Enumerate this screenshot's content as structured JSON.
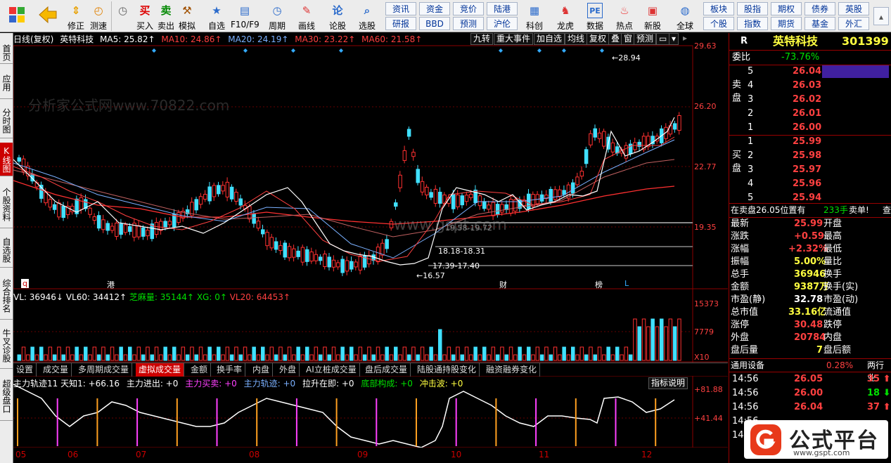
{
  "toolbar": {
    "big_buttons": [
      {
        "label": "",
        "icon": "grid-icon"
      },
      {
        "label": "",
        "icon": "back-arrow-icon"
      },
      {
        "label": "修正",
        "icon": "up-down-icon"
      },
      {
        "label": "测速",
        "icon": "stopwatch-icon"
      },
      {
        "label": "买入",
        "icon": "buy-icon",
        "glyph": "买"
      },
      {
        "label": "卖出",
        "icon": "sell-icon",
        "glyph": "卖"
      },
      {
        "label": "模拟",
        "icon": "hammer-icon"
      },
      {
        "label": "自选",
        "icon": "star-icon"
      },
      {
        "label": "F10/F9",
        "icon": "f10-icon"
      },
      {
        "label": "周期",
        "icon": "clock-icon"
      },
      {
        "label": "画线",
        "icon": "pencil-icon"
      },
      {
        "label": "论股",
        "icon": "lun-icon",
        "glyph": "论"
      },
      {
        "label": "选股",
        "icon": "magnifier-icon"
      }
    ],
    "small_buttons_row1": [
      "资讯",
      "资金",
      "竞价",
      "陆港"
    ],
    "small_buttons_row2": [
      "研报",
      "BBD",
      "预测",
      "沪伦"
    ],
    "big_buttons_right": [
      {
        "label": "科创",
        "icon": "kechuang-icon"
      },
      {
        "label": "龙虎",
        "icon": "tiger-icon"
      },
      {
        "label": "数据",
        "icon": "pe-icon",
        "glyph": "PE"
      },
      {
        "label": "热点",
        "icon": "hot-icon"
      },
      {
        "label": "新股",
        "icon": "new-stock-icon"
      },
      {
        "label": "全球",
        "icon": "globe-icon"
      }
    ],
    "small_buttons_right_row1": [
      "板块",
      "股指",
      "期权",
      "债券",
      "英股"
    ],
    "small_buttons_right_row2": [
      "个股",
      "指数",
      "期货",
      "基金",
      "外汇"
    ]
  },
  "leftbar": [
    "首页",
    "应用",
    "分时图",
    "K线图",
    "个股资料",
    "自选股",
    "综合排名",
    "牛叉诊股",
    "超级盘口"
  ],
  "chart_header": {
    "period": "日线(复权)",
    "name": "英特科技",
    "ma5": "MA5: 25.82↑",
    "ma10": "MA10: 24.86↑",
    "ma20": "MA20: 24.19↑",
    "ma30": "MA30: 23.22↑",
    "ma60": "MA60: 21.58↑",
    "buttons": [
      "九转",
      "重大事件",
      "加自选",
      "均线",
      "复权",
      "叠",
      "窗",
      "预测"
    ]
  },
  "price_axis": [
    "29.63",
    "26.20",
    "22.77",
    "19.35"
  ],
  "annotations": {
    "high": "28.94",
    "low": "16.57",
    "zone1": "18.18-18.31",
    "zone2": "17.39-17.40",
    "zone3": "19.58-19.72",
    "flag_gang": "港",
    "flag_cai": "财",
    "flag_bang": "榜",
    "flag_l": "L",
    "flag_q": "q"
  },
  "volume_header": {
    "vl": "VL: 36946↓",
    "vl60": "VL60: 34412↑",
    "zhima": "芝麻量: 35144↑",
    "xg": "XG: 0↑",
    "vl20": "VL20: 64453↑"
  },
  "volume_axis": [
    "15373",
    "7779",
    "X10"
  ],
  "tabs": [
    "设置",
    "成交量",
    "多周期成交量",
    "虚拟成交量",
    "金额",
    "换手率",
    "内盘",
    "外盘",
    "AI立桩成交量",
    "盘后成交量",
    "陆股通持股变化",
    "融资融券变化"
  ],
  "active_tab": "虚拟成交量",
  "indicator_header": {
    "l1": "主力轨迹11 天知1: +66.16",
    "l2": "主力进出: +0",
    "l3": "主力买卖: +0",
    "l4": "主力轨迹: +0",
    "l5": "拉升在即: +0",
    "l6": "底部构成: +0",
    "l7": "冲击波: +0",
    "help": "指标说明"
  },
  "indicator_axis": [
    "+81.88",
    "+41.44"
  ],
  "months": [
    "05",
    "06",
    "07",
    "08",
    "09",
    "10",
    "11",
    "12"
  ],
  "right_panel": {
    "tag": "R",
    "name": "英特科技",
    "code": "301399",
    "weibi_label": "委比",
    "weibi": "-73.76%",
    "sell_label": "卖盘",
    "buy_label": "买盘",
    "asks": [
      {
        "lvl": "5",
        "price": "26.04"
      },
      {
        "lvl": "4",
        "price": "26.03"
      },
      {
        "lvl": "3",
        "price": "26.02"
      },
      {
        "lvl": "2",
        "price": "26.01"
      },
      {
        "lvl": "1",
        "price": "26.00"
      }
    ],
    "bids": [
      {
        "lvl": "1",
        "price": "25.99"
      },
      {
        "lvl": "2",
        "price": "25.98"
      },
      {
        "lvl": "3",
        "price": "25.97"
      },
      {
        "lvl": "4",
        "price": "25.96"
      },
      {
        "lvl": "5",
        "price": "25.94"
      }
    ],
    "notice": "在卖盘26.05位置有",
    "notice_qty": "233手",
    "notice_tail": "卖单!",
    "notice_link": "查",
    "stats": [
      {
        "k": "最新",
        "v": "25.99",
        "k2": "开盘",
        "c": "red"
      },
      {
        "k": "涨跌",
        "v": "+0.59",
        "k2": "最高",
        "c": "red"
      },
      {
        "k": "涨幅",
        "v": "+2.32%",
        "k2": "最低",
        "c": "red"
      },
      {
        "k": "振幅",
        "v": "5.00%",
        "k2": "量比",
        "c": "yellow"
      },
      {
        "k": "总手",
        "v": "36946",
        "k2": "换手",
        "c": "yellow"
      },
      {
        "k": "金额",
        "v": "9387万",
        "k2": "换手(实)",
        "c": "yellow"
      },
      {
        "k": "市盈(静)",
        "v": "32.78",
        "k2": "市盈(动)",
        "c": "white"
      },
      {
        "k": "总市值",
        "v": "33.16亿",
        "k2": "流通值",
        "c": "yellow"
      },
      {
        "k": "涨停",
        "v": "30.48",
        "k2": "跌停",
        "c": "red"
      },
      {
        "k": "外盘",
        "v": "20784",
        "k2": "内盘",
        "c": "red"
      },
      {
        "k": "盘后量",
        "v": "7",
        "k2": "盘后额",
        "c": "yellow"
      }
    ],
    "sector": "通用设备",
    "sector_pct": "0.28%",
    "sector_link": "两行业",
    "ticks": [
      {
        "t": "14:56",
        "p": "26.05",
        "q": "35",
        "dir": "up"
      },
      {
        "t": "14:56",
        "p": "26.00",
        "q": "18",
        "dir": "down"
      },
      {
        "t": "14:56",
        "p": "26.04",
        "q": "37",
        "dir": "up"
      },
      {
        "t": "14:56",
        "p": "",
        "q": "",
        "dir": ""
      },
      {
        "t": "14:56",
        "p": "",
        "q": "",
        "dir": ""
      }
    ]
  },
  "logo": {
    "text": "公式平台",
    "url_text": "www.gspt.com"
  },
  "watermarks": [
    "分析家公式网www.70822.com",
    "www.gspt.com"
  ]
}
